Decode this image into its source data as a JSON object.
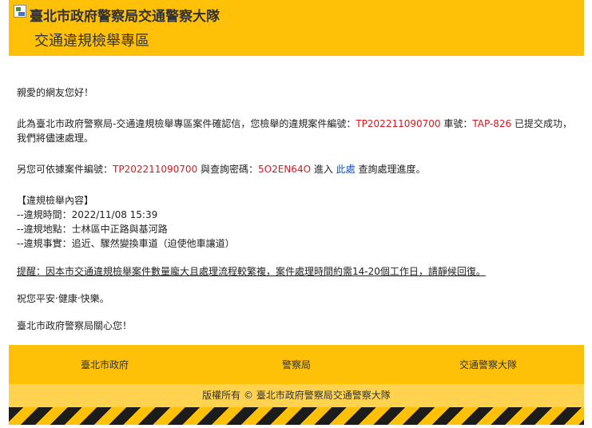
{
  "header": {
    "broken_image_alt": "",
    "title": "臺北市政府警察局交通警察大隊",
    "subtitle": "交通違規檢舉專區"
  },
  "content": {
    "greeting": "親愛的網友您好！",
    "confirm_prefix": "此為臺北市政府警察局-交通違規檢舉專區案件確認信，您檢舉的違規案件編號：",
    "case_number": "TP202211090700",
    "plate_label": " 車號：",
    "plate_number": "TAP-826",
    "confirm_suffix": " 已提交成功，我們將儘速處理。",
    "query_prefix": "另您可依據案件編號：",
    "query_case_number": "TP202211090700",
    "query_mid": " 與查詢密碼：",
    "query_password": "5O2EN64O",
    "query_enter": " 進入 ",
    "query_link": "此處",
    "query_suffix": " 查詢處理進度。",
    "details_heading": "【違規檢舉內容】",
    "time_label": "--違規時間：",
    "time_value": "2022/11/08 15:39",
    "location_label": "--違規地點：",
    "location_value": "士林區中正路與基河路",
    "fact_label": "--違規事實：",
    "fact_value": "追近、驟然變換車道（迫使他車讓道）",
    "reminder": "提醒：因本市交通違規檢舉案件數量龐大且處理流程較繁複，案件處理時間約需14-20個工作日，請靜候回復。",
    "wishes": "祝您平安‧健康‧快樂。",
    "signoff": "臺北市政府警察局關心您！"
  },
  "footer": {
    "links": [
      "臺北市政府",
      "警察局",
      "交通警察大隊"
    ],
    "copyright": "版權所有 © 臺北市政府警察局交通警察大隊"
  },
  "colors": {
    "header_bg": "#ffc107",
    "copyright_bg": "#ffd34f",
    "highlight_red": "#e0141e",
    "link_blue": "#1a4fb4",
    "stripe_dark": "#1c1c1c"
  }
}
